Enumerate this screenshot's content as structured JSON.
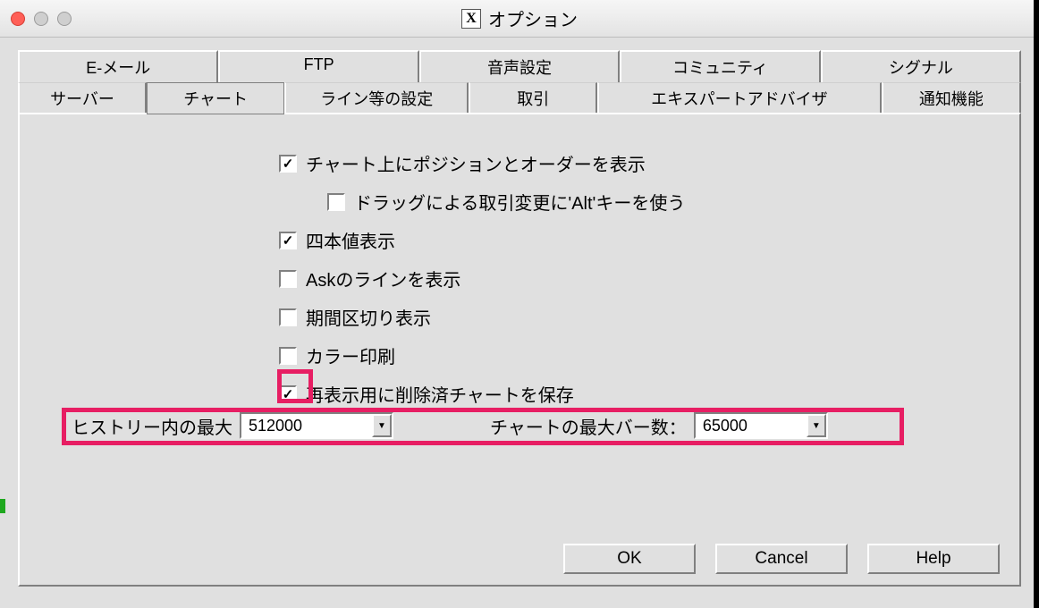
{
  "window": {
    "title": "オプション",
    "app_logo_glyph": "X"
  },
  "tabs_top": [
    {
      "label": "E-メール"
    },
    {
      "label": "FTP"
    },
    {
      "label": "音声設定"
    },
    {
      "label": "コミュニティ"
    },
    {
      "label": "シグナル"
    }
  ],
  "tabs_bottom": [
    {
      "label": "サーバー"
    },
    {
      "label": "チャート",
      "active": true
    },
    {
      "label": "ライン等の設定"
    },
    {
      "label": "取引"
    },
    {
      "label": "エキスパートアドバイザ"
    },
    {
      "label": "通知機能"
    }
  ],
  "options": [
    {
      "label": "チャート上にポジションとオーダーを表示",
      "checked": true
    },
    {
      "label": "ドラッグによる取引変更に'Alt'キーを使う",
      "checked": false,
      "indent": true
    },
    {
      "label": "四本値表示",
      "checked": true
    },
    {
      "label": "Askのラインを表示",
      "checked": false
    },
    {
      "label": "期間区切り表示",
      "checked": false
    },
    {
      "label": "カラー印刷",
      "checked": false
    },
    {
      "label": "再表示用に削除済チャートを保存",
      "checked": true
    }
  ],
  "combos": {
    "history_label": "ヒストリー内の最大",
    "history_value": "512000",
    "chartbars_label": "チャートの最大バー数：",
    "chartbars_value": "65000"
  },
  "buttons": {
    "ok": "OK",
    "cancel": "Cancel",
    "help": "Help"
  }
}
